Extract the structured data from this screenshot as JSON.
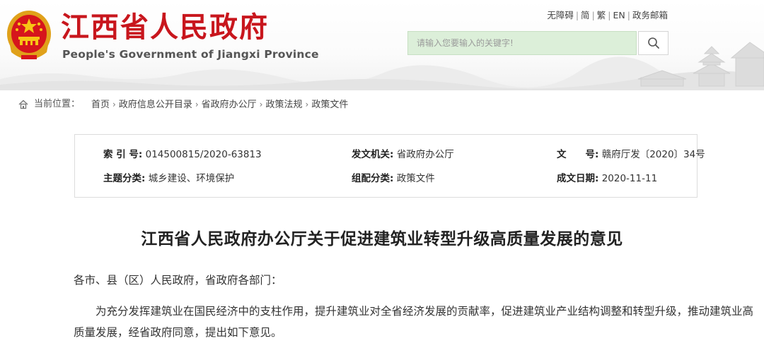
{
  "header": {
    "site_title": "江西省人民政府",
    "site_subtitle": "People's Government of Jiangxi Province",
    "top_links": [
      "无障碍",
      "简",
      "繁",
      "EN",
      "政务邮箱"
    ],
    "search_placeholder": "请输入您要输入的关键字!"
  },
  "breadcrumb": {
    "label": "当前位置：",
    "items": [
      "首页",
      "政府信息公开目录",
      "省政府办公厅",
      "政策法规",
      "政策文件"
    ]
  },
  "meta": {
    "index_key": "索 引 号:",
    "index_value": "014500815/2020-63813",
    "issuer_key": "发文机关:",
    "issuer_value": "省政府办公厅",
    "docno_key": "文　　号:",
    "docno_value": "赣府厅发〔2020〕34号",
    "topic_key": "主题分类:",
    "topic_value": "城乡建设、环境保护",
    "category_key": "组配分类:",
    "category_value": "政策文件",
    "date_key": "成文日期:",
    "date_value": "2020-11-11"
  },
  "document": {
    "title": "江西省人民政府办公厅关于促进建筑业转型升级高质量发展的意见",
    "salutation": "各市、县（区）人民政府，省政府各部门：",
    "body": "为充分发挥建筑业在国民经济中的支柱作用，提升建筑业对全省经济发展的贡献率，促进建筑业产业结构调整和转型升级，推动建筑业高质量发展，经省政府同意，提出如下意见。"
  },
  "colors": {
    "title_red": "#c8161d",
    "search_bg": "#dcefd9"
  },
  "icons": [
    "national-emblem-icon",
    "search-icon",
    "home-icon",
    "chevron-right-icon"
  ]
}
